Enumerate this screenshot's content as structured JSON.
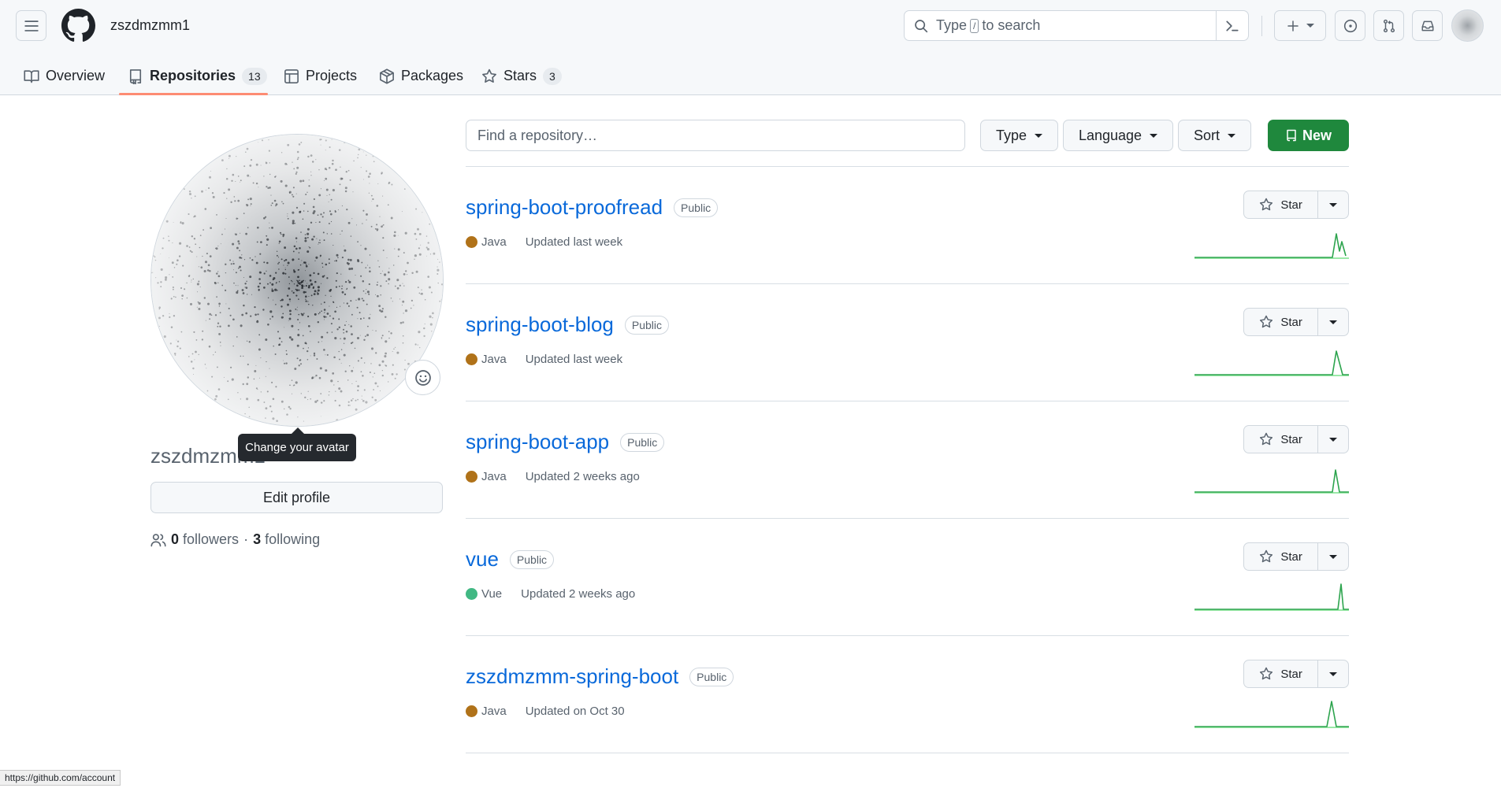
{
  "header": {
    "username": "zszdmzmm1",
    "search_placeholder_pre": "Type",
    "search_key": "/",
    "search_placeholder_post": "to search"
  },
  "tabs": [
    {
      "label": "Overview",
      "icon": "book-icon"
    },
    {
      "label": "Repositories",
      "icon": "repo-icon",
      "count": "13",
      "active": true
    },
    {
      "label": "Projects",
      "icon": "table-icon"
    },
    {
      "label": "Packages",
      "icon": "package-icon"
    },
    {
      "label": "Stars",
      "icon": "star-icon",
      "count": "3"
    }
  ],
  "profile": {
    "name": "zszdmzmm1",
    "tooltip": "Change your avatar",
    "edit_label": "Edit profile",
    "followers_count": "0",
    "followers_label": "followers",
    "separator": "·",
    "following_count": "3",
    "following_label": "following"
  },
  "filters": {
    "find_placeholder": "Find a repository…",
    "type_label": "Type",
    "language_label": "Language",
    "sort_label": "Sort",
    "new_label": "New"
  },
  "repos": [
    {
      "name": "spring-boot-proofread",
      "visibility": "Public",
      "language": "Java",
      "lang_color": "#b07219",
      "updated": "Updated last week",
      "star_label": "Star"
    },
    {
      "name": "spring-boot-blog",
      "visibility": "Public",
      "language": "Java",
      "lang_color": "#b07219",
      "updated": "Updated last week",
      "star_label": "Star"
    },
    {
      "name": "spring-boot-app",
      "visibility": "Public",
      "language": "Java",
      "lang_color": "#b07219",
      "updated": "Updated 2 weeks ago",
      "star_label": "Star"
    },
    {
      "name": "vue",
      "visibility": "Public",
      "language": "Vue",
      "lang_color": "#41b883",
      "updated": "Updated 2 weeks ago",
      "star_label": "Star"
    },
    {
      "name": "zszdmzmm-spring-boot",
      "visibility": "Public",
      "language": "Java",
      "lang_color": "#b07219",
      "updated": "Updated on Oct 30",
      "star_label": "Star"
    }
  ],
  "status_bar": {
    "url": "https://github.com/account"
  },
  "colors": {
    "accent_green": "#1f883d",
    "link_blue": "#0969da",
    "tab_underline": "#fd8c73",
    "spark_line": "#2da44e"
  }
}
